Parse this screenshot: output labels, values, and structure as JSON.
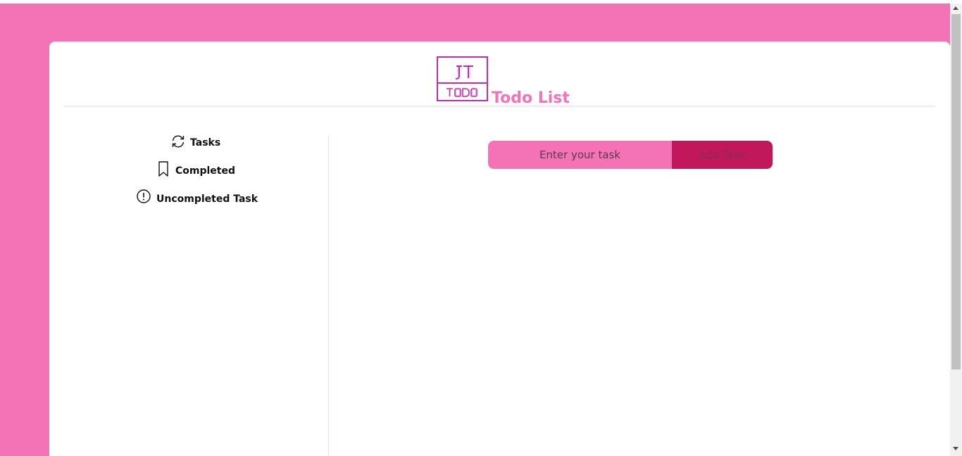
{
  "header": {
    "logo_icon": "jt-todo-logo-icon",
    "title": "Todo List"
  },
  "sidebar": {
    "items": [
      {
        "icon": "refresh-icon",
        "label": "Tasks"
      },
      {
        "icon": "bookmark-icon",
        "label": "Completed"
      },
      {
        "icon": "alert-circle-icon",
        "label": "Uncompleted Task"
      }
    ]
  },
  "task_form": {
    "placeholder": "Enter your task",
    "button_label": "Add Task"
  },
  "colors": {
    "background": "#f472b6",
    "accent": "#c0185a",
    "logo": "#c02db0"
  }
}
